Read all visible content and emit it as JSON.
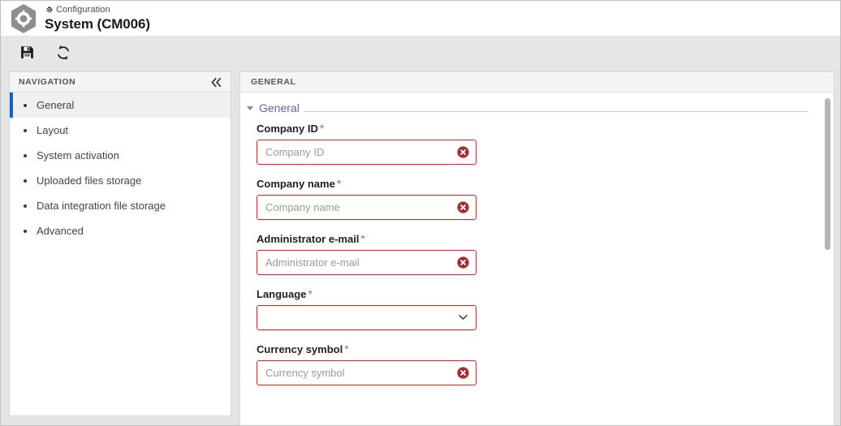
{
  "window": {
    "kicker": "Configuration",
    "title": "System (CM006)",
    "logo_icon": "hexagon-gear-icon",
    "kicker_icon": "gear-icon"
  },
  "toolbar": {
    "buttons": [
      {
        "name": "save-button",
        "icon": "floppy-disk-save-icon",
        "label": "Save"
      },
      {
        "name": "refresh-button",
        "icon": "refresh-sync-icon",
        "label": "Refresh"
      }
    ]
  },
  "navigation": {
    "header_title": "NAVIGATION",
    "collapse_icon": "double-chevron-left-icon",
    "items": [
      {
        "label": "General",
        "selected": true
      },
      {
        "label": "Layout",
        "selected": false
      },
      {
        "label": "System activation",
        "selected": false
      },
      {
        "label": "Uploaded files storage",
        "selected": false
      },
      {
        "label": "Data integration file storage",
        "selected": false
      },
      {
        "label": "Advanced",
        "selected": false
      }
    ]
  },
  "content": {
    "header_title": "GENERAL",
    "section": {
      "label": "General",
      "expanded": true,
      "caret_icon": "caret-down-icon"
    },
    "fields": [
      {
        "label": "Company ID",
        "required": true,
        "type": "text",
        "value": "",
        "placeholder": "Company ID",
        "error": true,
        "error_icon": "error-circle-x-icon"
      },
      {
        "label": "Company name",
        "required": true,
        "type": "text",
        "value": "",
        "placeholder": "Company name",
        "error": true,
        "error_icon": "error-circle-x-icon"
      },
      {
        "label": "Administrator e-mail",
        "required": true,
        "type": "text",
        "value": "",
        "placeholder": "Administrator e-mail",
        "error": true,
        "error_icon": "error-circle-x-icon"
      },
      {
        "label": "Language",
        "required": true,
        "type": "select",
        "value": "",
        "placeholder": "",
        "error": true,
        "chevron_icon": "chevron-down-icon",
        "options": [
          ""
        ]
      },
      {
        "label": "Currency symbol",
        "required": true,
        "type": "text",
        "value": "",
        "placeholder": "Currency symbol",
        "error": true,
        "error_icon": "error-circle-x-icon"
      }
    ]
  },
  "colors": {
    "accent_blue": "#1565c0",
    "link_violet": "#5a63b8",
    "error_border": "#b03a3a",
    "error_icon": "#9e2b2b",
    "required_star": "#e8505b",
    "toolbar_bg": "#e6e6e6",
    "panel_header_bg": "#f5f5f5",
    "page_bg": "#e4e4e4"
  }
}
